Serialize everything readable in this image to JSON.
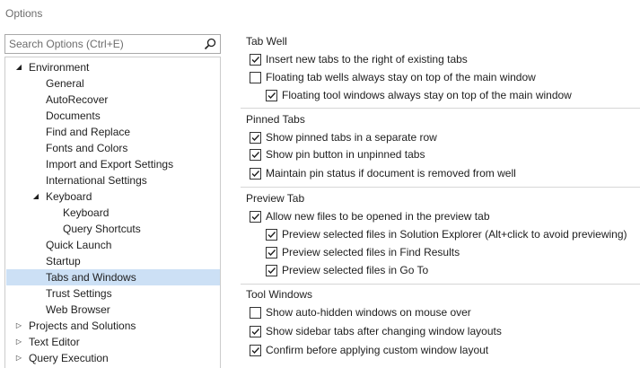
{
  "window": {
    "title": "Options"
  },
  "search": {
    "placeholder": "Search Options (Ctrl+E)",
    "value": "",
    "icon": "search-icon"
  },
  "tree": {
    "items": [
      {
        "label": "Environment",
        "expanded": true,
        "level": 0
      },
      {
        "label": "General",
        "level": 1
      },
      {
        "label": "AutoRecover",
        "level": 1
      },
      {
        "label": "Documents",
        "level": 1
      },
      {
        "label": "Find and Replace",
        "level": 1
      },
      {
        "label": "Fonts and Colors",
        "level": 1
      },
      {
        "label": "Import and Export Settings",
        "level": 1
      },
      {
        "label": "International Settings",
        "level": 1
      },
      {
        "label": "Keyboard",
        "expanded": true,
        "level": 1
      },
      {
        "label": "Keyboard",
        "level": 2
      },
      {
        "label": "Query Shortcuts",
        "level": 2
      },
      {
        "label": "Quick Launch",
        "level": 1
      },
      {
        "label": "Startup",
        "level": 1
      },
      {
        "label": "Tabs and Windows",
        "level": 1,
        "selected": true
      },
      {
        "label": "Trust Settings",
        "level": 1
      },
      {
        "label": "Web Browser",
        "level": 1
      },
      {
        "label": "Projects and Solutions",
        "expanded": false,
        "level": 0
      },
      {
        "label": "Text Editor",
        "expanded": false,
        "level": 0
      },
      {
        "label": "Query Execution",
        "expanded": false,
        "level": 0
      }
    ]
  },
  "groups": {
    "tab_well": {
      "heading": "Tab Well",
      "options": [
        {
          "label": "Insert new tabs to the right of existing tabs",
          "checked": true
        },
        {
          "label": "Floating tab wells always stay on top of the main window",
          "checked": false
        },
        {
          "label": "Floating tool windows always stay on top of the main window",
          "checked": true
        }
      ]
    },
    "pinned_tabs": {
      "heading": "Pinned Tabs",
      "options": [
        {
          "label": "Show pinned tabs in a separate row",
          "checked": true
        },
        {
          "label": "Show pin button in unpinned tabs",
          "checked": true
        },
        {
          "label": "Maintain pin status if document is removed from well",
          "checked": true
        }
      ]
    },
    "preview_tab": {
      "heading": "Preview Tab",
      "options": [
        {
          "label": "Allow new files to be opened in the preview tab",
          "checked": true
        },
        {
          "label": "Preview selected files in Solution Explorer (Alt+click to avoid previewing)",
          "checked": true
        },
        {
          "label": "Preview selected files in Find Results",
          "checked": true
        },
        {
          "label": "Preview selected files in Go To",
          "checked": true
        }
      ]
    },
    "tool_windows": {
      "heading": "Tool Windows",
      "options": [
        {
          "label": "Show auto-hidden windows on mouse over",
          "checked": false
        },
        {
          "label": "Show sidebar tabs after changing window layouts",
          "checked": true
        },
        {
          "label": "Confirm before applying custom window layout",
          "checked": true
        }
      ]
    }
  },
  "colors": {
    "selection": "#cce0f5",
    "border": "#cccccc",
    "text": "#1e1e1e",
    "muted": "#6d6d6d"
  }
}
